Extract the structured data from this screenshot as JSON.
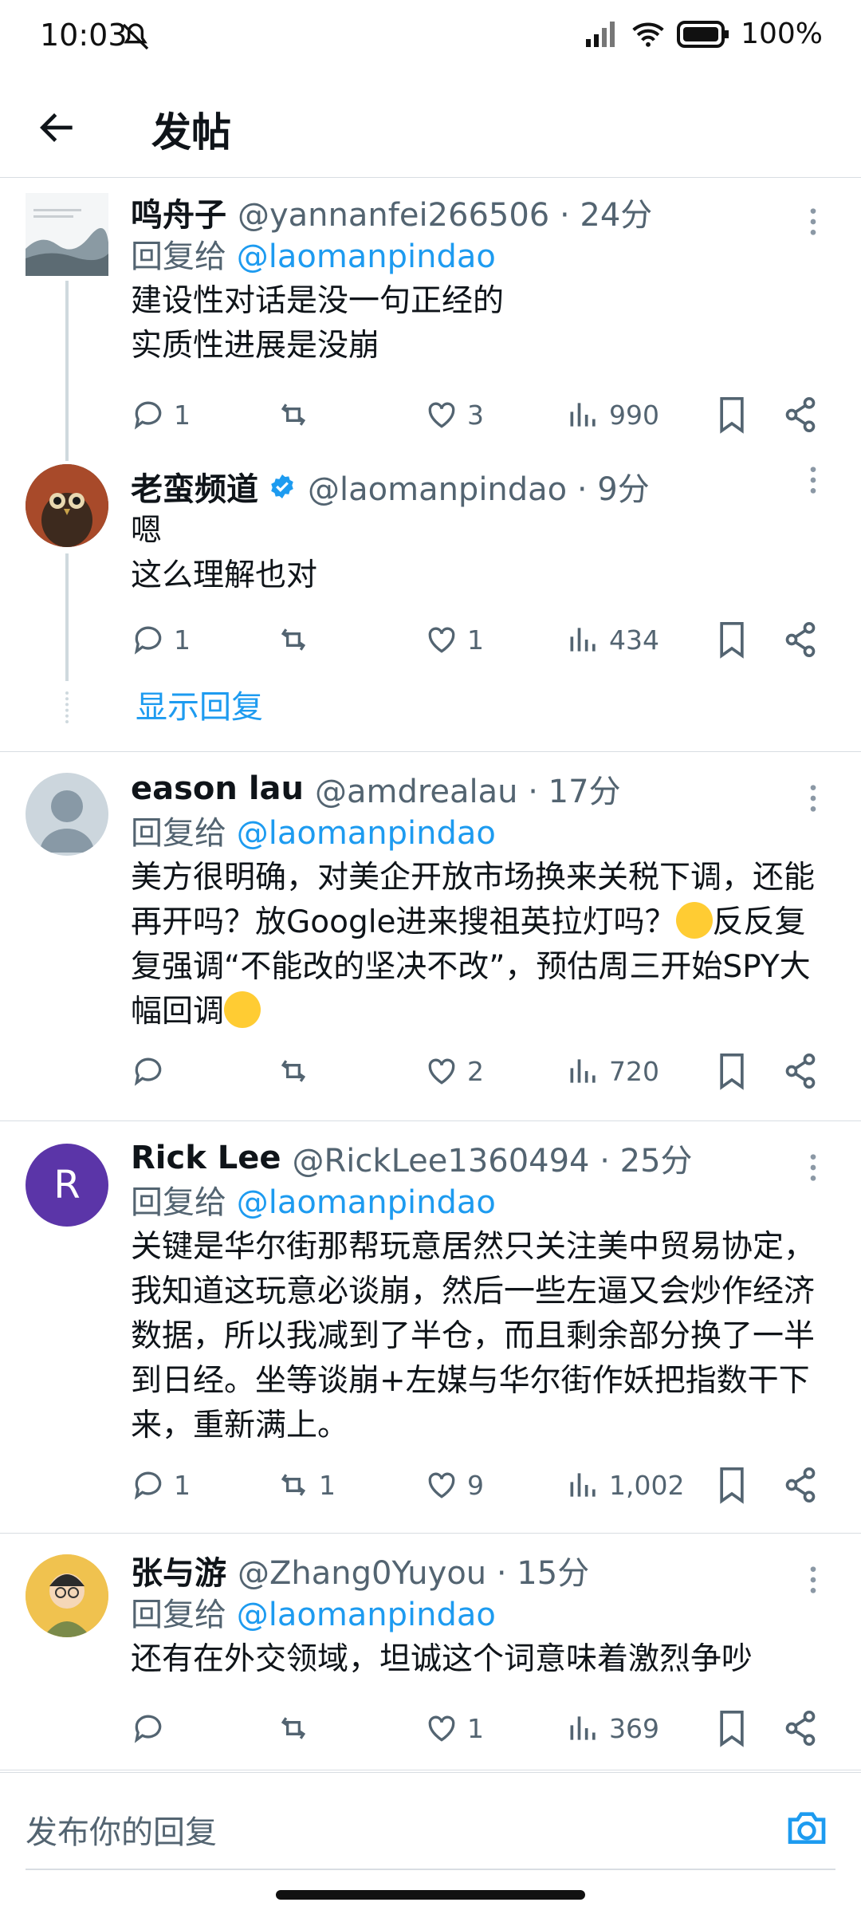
{
  "status_bar": {
    "time": "10:03",
    "battery": "100%"
  },
  "header": {
    "title": "发帖"
  },
  "show_replies": "显示回复",
  "tweets": [
    {
      "name": "鸣舟子",
      "handle": "@yannanfei266506 · 24分",
      "reply_to_prefix": "回复给",
      "reply_to_user": "@laomanpindao",
      "text": "建设性对话是没一句正经的\n实质性进展是没崩",
      "replies": "1",
      "retweets": "",
      "likes": "3",
      "views": "990"
    },
    {
      "name": "老蛮频道",
      "handle": "@laomanpindao · 9分",
      "text": "嗯\n这么理解也对",
      "replies": "1",
      "retweets": "",
      "likes": "1",
      "views": "434"
    },
    {
      "name": "eason lau",
      "handle": "@amdrealau · 17分",
      "reply_to_prefix": "回复给",
      "reply_to_user": "@laomanpindao",
      "text_before_emoji1": "美方很明确，对美企开放市场换来关税下调，还能再开吗？放Google进来搜祖英拉灯吗？",
      "text_after_emoji1": "反反复复强调“不能改的坚决不改”，预估周三开始SPY大幅回调",
      "replies": "",
      "retweets": "",
      "likes": "2",
      "views": "720"
    },
    {
      "name": "Rick Lee",
      "handle": "@RickLee1360494 · 25分",
      "avatar_letter": "R",
      "reply_to_prefix": "回复给",
      "reply_to_user": "@laomanpindao",
      "text": "关键是华尔街那帮玩意居然只关注美中贸易协定，我知道这玩意必谈崩，然后一些左逼又会炒作经济数据，所以我减到了半仓，而且剩余部分换了一半到日经。坐等谈崩+左媒与华尔街作妖把指数干下来，重新满上。",
      "replies": "1",
      "retweets": "1",
      "likes": "9",
      "views": "1,002"
    },
    {
      "name": "张与游",
      "handle": "@Zhang0Yuyou · 15分",
      "reply_to_prefix": "回复给",
      "reply_to_user": "@laomanpindao",
      "text": "还有在外交领域，坦诚这个词意味着激烈争吵",
      "replies": "",
      "retweets": "",
      "likes": "1",
      "views": "369"
    }
  ],
  "reply_bar": {
    "placeholder": "发布你的回复"
  },
  "colors": {
    "accent": "#1d9bf0",
    "secondary": "#536471",
    "verified": "#1d9bf0",
    "avatar_rick": "#5b35a8"
  }
}
